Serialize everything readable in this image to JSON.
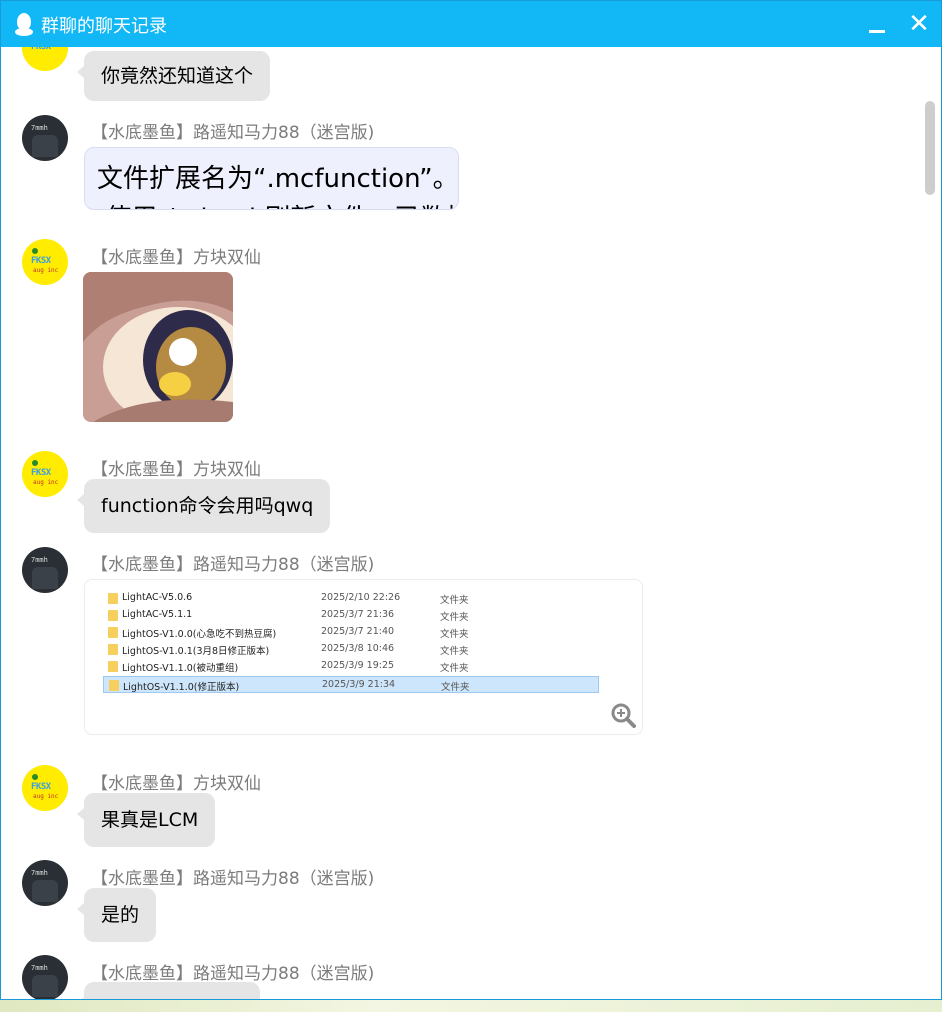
{
  "window": {
    "title": "群聊的聊天记录",
    "accent": "#12b7f5"
  },
  "messages": [
    {
      "sender": "",
      "type": "text",
      "text": "你竟然还知道这个"
    },
    {
      "sender": "【水底墨鱼】路遥知马力88（迷宫版)",
      "type": "text",
      "line1": "文件扩展名为“.mcfunction”。",
      "line2": "·使用 /reload 刷新文件，已数据"
    },
    {
      "sender": "【水底墨鱼】方块双仙",
      "type": "image"
    },
    {
      "sender": "【水底墨鱼】方块双仙",
      "type": "text",
      "text": "function命令会用吗qwq"
    },
    {
      "sender": "【水底墨鱼】路遥知马力88（迷宫版)",
      "type": "image"
    },
    {
      "sender": "【水底墨鱼】方块双仙",
      "type": "text",
      "text": "果真是LCM"
    },
    {
      "sender": "【水底墨鱼】路遥知马力88（迷宫版)",
      "type": "text",
      "text": "是的"
    },
    {
      "sender": "【水底墨鱼】路遥知马力88（迷宫版)",
      "type": "text",
      "text": ""
    }
  ],
  "file_list": [
    {
      "name": "LightAC-V5.0.6",
      "date": "2025/2/10 22:26",
      "type": "文件夹"
    },
    {
      "name": "LightAC-V5.1.1",
      "date": "2025/3/7 21:36",
      "type": "文件夹"
    },
    {
      "name": "LightOS-V1.0.0(心急吃不到热豆腐)",
      "date": "2025/3/7 21:40",
      "type": "文件夹"
    },
    {
      "name": "LightOS-V1.0.1(3月8日修正版本)",
      "date": "2025/3/8 10:46",
      "type": "文件夹"
    },
    {
      "name": "LightOS-V1.1.0(被动重组)",
      "date": "2025/3/9 19:25",
      "type": "文件夹"
    },
    {
      "name": "LightOS-V1.1.0(修正版本)",
      "date": "2025/3/9 21:34",
      "type": "文件夹"
    }
  ],
  "icons": [
    "qq-penguin-icon",
    "minimize-icon",
    "close-icon",
    "zoom-in-icon",
    "folder-icon"
  ]
}
